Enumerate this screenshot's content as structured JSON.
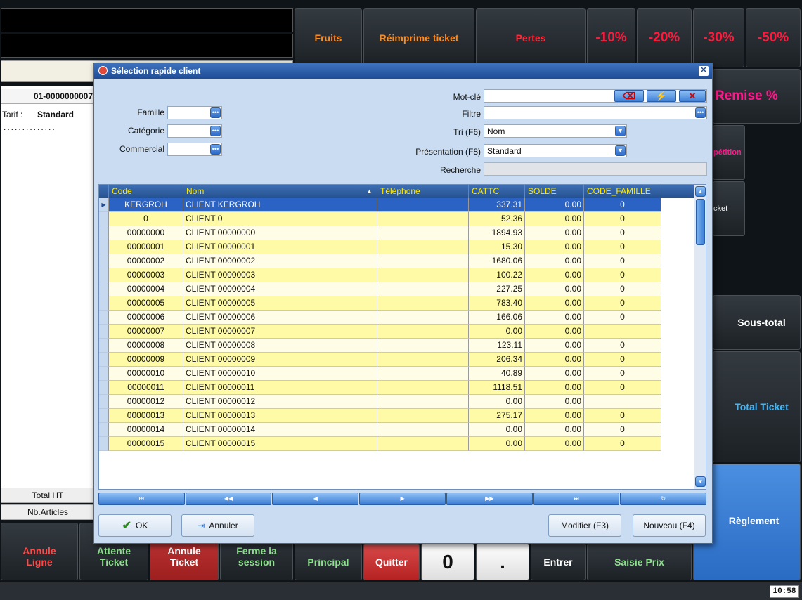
{
  "pos": {
    "top_buttons": [
      "Fruits",
      "Réimprime ticket",
      "Pertes",
      "-10%",
      "-20%",
      "-30%",
      "-50%"
    ],
    "ticket_number": "01-0000000007",
    "tarif_label": "Tarif :",
    "tarif_value": "Standard",
    "dotted_line": "..............",
    "right_buttons": [
      "Remise %",
      "pétition",
      "cket",
      "Sous-total",
      "Total Ticket",
      "Règlement"
    ],
    "total_ht_label": "Total HT",
    "nb_articles_label": "Nb.Articles",
    "bottom_buttons": [
      "Annule Ligne",
      "Attente Ticket",
      "Annule Ticket",
      "Ferme la session",
      "Principal",
      "Quitter",
      "0",
      ".",
      "Entrer",
      "Saisie Prix"
    ],
    "clock": "10:58"
  },
  "dialog": {
    "title": "Sélection rapide client",
    "labels": {
      "famille": "Famille",
      "categorie": "Catégorie",
      "commercial": "Commercial",
      "motcle": "Mot-clé",
      "filtre": "Filtre",
      "tri": "Tri (F6)",
      "presentation": "Présentation (F8)",
      "recherche": "Recherche"
    },
    "tri_value": "Nom",
    "presentation_value": "Standard",
    "columns": [
      "Code",
      "Nom",
      "Téléphone",
      "CATTC",
      "SOLDE",
      "CODE_FAMILLE"
    ],
    "rows": [
      {
        "code": "KERGROH",
        "nom": "CLIENT  KERGROH",
        "tel": "",
        "cattc": "337.31",
        "solde": "0.00",
        "fam": "0"
      },
      {
        "code": "0",
        "nom": "CLIENT 0",
        "tel": "",
        "cattc": "52.36",
        "solde": "0.00",
        "fam": "0"
      },
      {
        "code": "00000000",
        "nom": "CLIENT 00000000",
        "tel": "",
        "cattc": "1894.93",
        "solde": "0.00",
        "fam": "0"
      },
      {
        "code": "00000001",
        "nom": "CLIENT 00000001",
        "tel": "",
        "cattc": "15.30",
        "solde": "0.00",
        "fam": "0"
      },
      {
        "code": "00000002",
        "nom": "CLIENT 00000002",
        "tel": "",
        "cattc": "1680.06",
        "solde": "0.00",
        "fam": "0"
      },
      {
        "code": "00000003",
        "nom": "CLIENT 00000003",
        "tel": "",
        "cattc": "100.22",
        "solde": "0.00",
        "fam": "0"
      },
      {
        "code": "00000004",
        "nom": "CLIENT 00000004",
        "tel": "",
        "cattc": "227.25",
        "solde": "0.00",
        "fam": "0"
      },
      {
        "code": "00000005",
        "nom": "CLIENT 00000005",
        "tel": "",
        "cattc": "783.40",
        "solde": "0.00",
        "fam": "0"
      },
      {
        "code": "00000006",
        "nom": "CLIENT 00000006",
        "tel": "",
        "cattc": "166.06",
        "solde": "0.00",
        "fam": "0"
      },
      {
        "code": "00000007",
        "nom": "CLIENT 00000007",
        "tel": "",
        "cattc": "0.00",
        "solde": "0.00",
        "fam": ""
      },
      {
        "code": "00000008",
        "nom": "CLIENT 00000008",
        "tel": "",
        "cattc": "123.11",
        "solde": "0.00",
        "fam": "0"
      },
      {
        "code": "00000009",
        "nom": "CLIENT 00000009",
        "tel": "",
        "cattc": "206.34",
        "solde": "0.00",
        "fam": "0"
      },
      {
        "code": "00000010",
        "nom": "CLIENT 00000010",
        "tel": "",
        "cattc": "40.89",
        "solde": "0.00",
        "fam": "0"
      },
      {
        "code": "00000011",
        "nom": "CLIENT 00000011",
        "tel": "",
        "cattc": "1118.51",
        "solde": "0.00",
        "fam": "0"
      },
      {
        "code": "00000012",
        "nom": "CLIENT 00000012",
        "tel": "",
        "cattc": "0.00",
        "solde": "0.00",
        "fam": ""
      },
      {
        "code": "00000013",
        "nom": "CLIENT 00000013",
        "tel": "",
        "cattc": "275.17",
        "solde": "0.00",
        "fam": "0"
      },
      {
        "code": "00000014",
        "nom": "CLIENT 00000014",
        "tel": "",
        "cattc": "0.00",
        "solde": "0.00",
        "fam": "0"
      },
      {
        "code": "00000015",
        "nom": "CLIENT 00000015",
        "tel": "",
        "cattc": "0.00",
        "solde": "0.00",
        "fam": "0"
      }
    ],
    "buttons": {
      "ok": "OK",
      "annuler": "Annuler",
      "modifier": "Modifier (F3)",
      "nouveau": "Nouveau (F4)"
    }
  }
}
